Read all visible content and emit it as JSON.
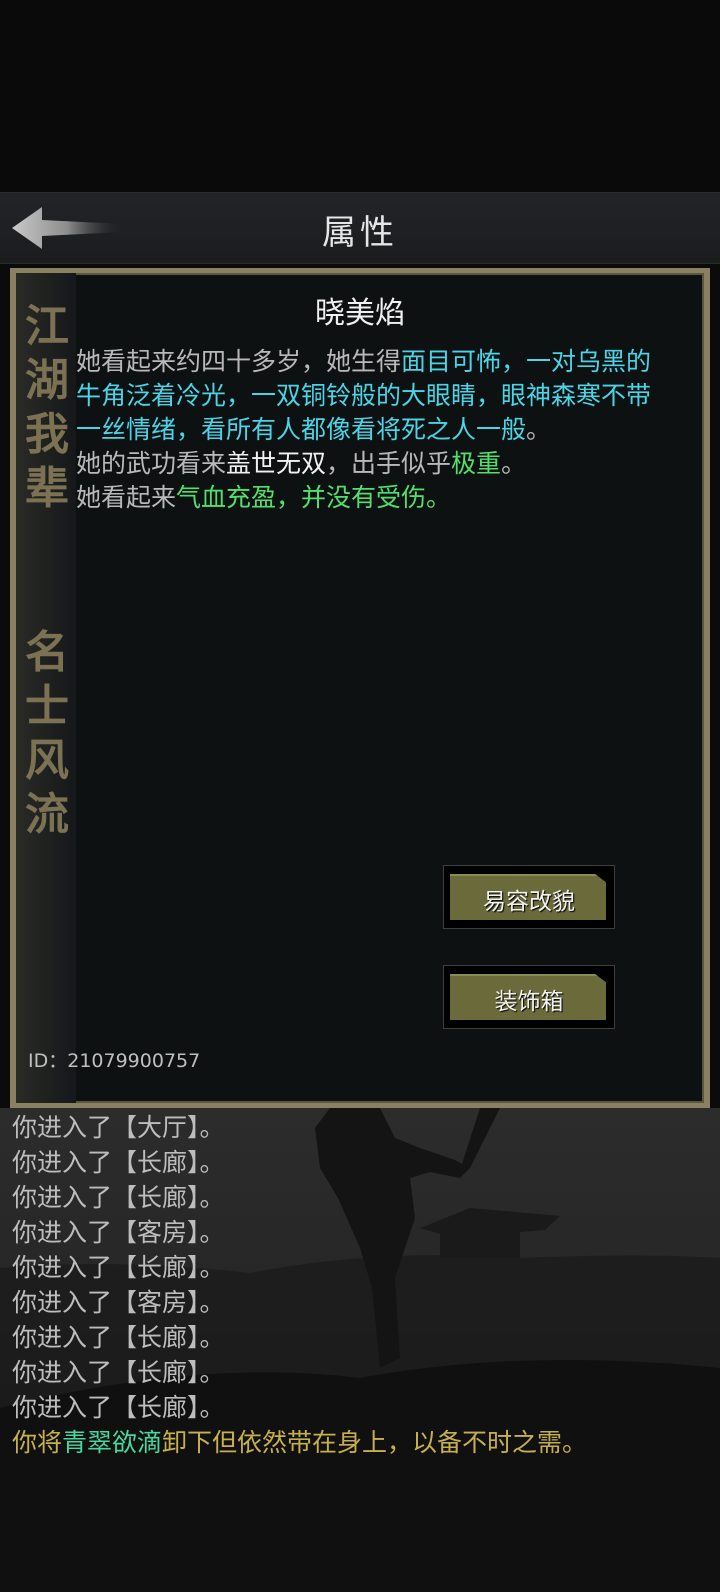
{
  "header": {
    "title": "属性"
  },
  "side_text": {
    "top": "江湖我辈",
    "bottom": "名士风流"
  },
  "character": {
    "name": "晓美焰",
    "description": {
      "line1_prefix": "她看起来约四十多岁，她生得",
      "line1_highlight": "面目可怖，一对乌黑的牛角泛着冷光，一双铜铃般的大眼睛，眼神森寒不带一丝情绪，看所有人都像看将死之人一般",
      "line1_suffix": "。",
      "line2_prefix": "她的武功看来",
      "line2_white": "盖世无双",
      "line2_middle": "，出手似乎",
      "line2_green": "极重",
      "line2_suffix": "。",
      "line3_prefix": "她看起来",
      "line3_green": "气血充盈，并没有受伤。"
    },
    "buttons": {
      "disguise": "易容改貌",
      "decoration_box": "装饰箱"
    },
    "id_label": "ID：21079900757"
  },
  "log": {
    "entries": [
      "你进入了【大厅】。",
      "你进入了【长廊】。",
      "你进入了【长廊】。",
      "你进入了【客房】。",
      "你进入了【长廊】。",
      "你进入了【客房】。",
      "你进入了【长廊】。",
      "你进入了【长廊】。",
      "你进入了【长廊】。"
    ],
    "final": {
      "prefix": "你将",
      "item": "青翠欲滴",
      "suffix": "卸下但依然带在身上，以备不时之需。"
    }
  },
  "colors": {
    "panel_border": "#8a8162",
    "cyan_text": "#4ad4e6",
    "green_text": "#52e06d",
    "button_olive": "#6b6a3a",
    "log_gold": "#c7b04b"
  },
  "icons": {
    "back": "back-arrow-icon"
  }
}
